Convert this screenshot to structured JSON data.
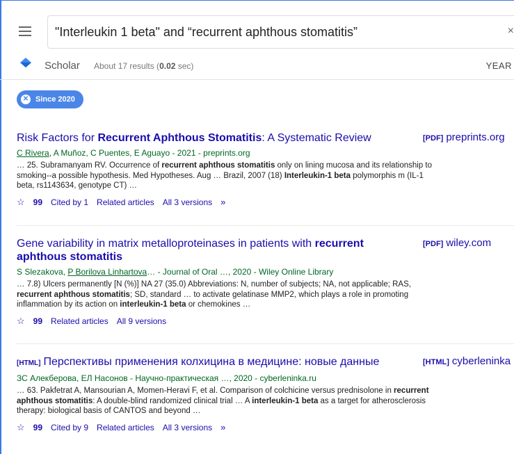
{
  "search": {
    "query": "\"Interleukin 1 beta\" and “recurrent aphthous stomatitis”"
  },
  "header": {
    "brand": "Scholar",
    "results_prefix": "About 17 results (",
    "results_time": "0.02",
    "results_suffix": " sec)",
    "year_label": "YEAR"
  },
  "filter": {
    "chip_label": "Since 2020"
  },
  "results": [
    {
      "title_plain": "Risk Factors for ",
      "title_bold": "Recurrent Aphthous Stomatitis",
      "title_rest": ": A Systematic Review",
      "side_tag": "[PDF]",
      "side_source": "preprints.org",
      "authors_link": "C Rivera",
      "authors_rest": ", A Muñoz, C Puentes, E Aguayo - 2021 - preprints.org",
      "snippet": [
        {
          "t": "… 25. Subramanyam RV. Occurrence of "
        },
        {
          "b": "recurrent aphthous stomatitis"
        },
        {
          "t": " only on lining mucosa and its relationship to smoking--a possible hypothesis. Med Hypotheses. Aug … Brazil, 2007 (18) "
        },
        {
          "b": "Interleukin-1 beta"
        },
        {
          "t": " polymorphis m (IL-1 beta, rs1143634, genotype CT) …"
        }
      ],
      "cited": "Cited by 1",
      "related": "Related articles",
      "versions": "All 3 versions"
    },
    {
      "title_plain": "Gene variability in matrix metalloproteinases in patients with ",
      "title_bold": "recurrent aphthous stomatitis",
      "title_rest": "",
      "side_tag": "[PDF]",
      "side_source": "wiley.com",
      "authors_pre": "S Slezakova, ",
      "authors_link": "P Borilova Linhartova",
      "authors_rest": "… - Journal of Oral …, 2020 - Wiley Online Library",
      "snippet": [
        {
          "t": "… 7.8) Ulcers permanently [N (%)] NA 27 (35.0) Abbreviations: N, number of subjects; NA, not applicable; RAS, "
        },
        {
          "b": "recurrent aphthous stomatitis"
        },
        {
          "t": "; SD, standard … to activate gelatinase MMP2, which plays a role in promoting inflammation by its action on "
        },
        {
          "b": "interleukin-1 beta"
        },
        {
          "t": " or chemokines …"
        }
      ],
      "related": "Related articles",
      "versions": "All 9 versions"
    },
    {
      "title_tag": "[HTML]",
      "title_plain": "Перспективы применения колхицина в медицине: новые данные",
      "side_tag": "[HTML]",
      "side_source": "cyberleninka",
      "authors_rest": "ЗС Алекберова, ЕЛ Насонов - Научно-практическая …, 2020 - cyberleninka.ru",
      "snippet": [
        {
          "t": "… 63. Pakfetrat A, Mansourian A, Momen-Heravi F, et al. Comparison of colchicine versus prednisolone in "
        },
        {
          "b": "recurrent aphthous stomatitis"
        },
        {
          "t": ": A double-blind randomized clinical trial … A "
        },
        {
          "b": "interleukin-1 beta"
        },
        {
          "t": " as a target for atherosclerosis therapy: biological basis of CANTOS and beyond …"
        }
      ],
      "cited": "Cited by 9",
      "related": "Related articles",
      "versions": "All 3 versions"
    }
  ],
  "colors": {
    "link": "#1a0dab",
    "green": "#006621",
    "chip": "#4a86e8"
  }
}
